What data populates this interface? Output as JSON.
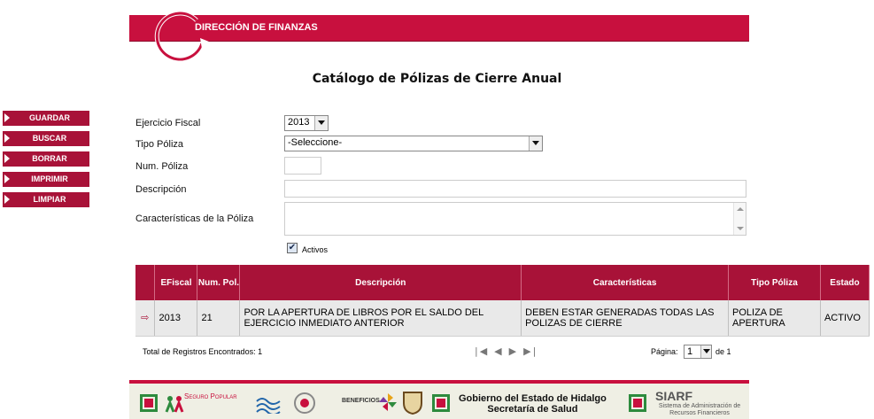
{
  "header": {
    "title": "DIRECCIÓN DE FINANZAS"
  },
  "page_title": "Catálogo de Pólizas de Cierre Anual",
  "side_menu": [
    "GUARDAR",
    "BUSCAR",
    "BORRAR",
    "IMPRIMIR",
    "LIMPIAR"
  ],
  "form": {
    "ejercicio_label": "Ejercicio Fiscal",
    "ejercicio_value": "2013",
    "tipo_label": "Tipo Póliza",
    "tipo_value": "-Seleccione-",
    "num_label": "Num. Póliza",
    "num_value": "",
    "desc_label": "Descripción",
    "desc_value": "",
    "carac_label": "Características de la Póliza",
    "carac_value": "",
    "activos_label": "Activos",
    "activos_checked": true
  },
  "table": {
    "headers": [
      "",
      "EFiscal",
      "Num. Pol.",
      "Descripción",
      "Características",
      "Tipo Póliza",
      "Estado"
    ],
    "rows": [
      {
        "efiscal": "2013",
        "num": "21",
        "descripcion": "POR LA APERTURA DE LIBROS POR EL SALDO DEL EJERCICIO INMEDIATO ANTERIOR",
        "caracteristicas": "DEBEN ESTAR GENERADAS TODAS LAS POLIZAS DE CIERRE",
        "tipo": "POLIZA DE APERTURA",
        "estado": "ACTIVO"
      }
    ]
  },
  "footer_bar": {
    "total": "Total de Registros Encontrados: 1",
    "page_label": "Página:",
    "page_value": "1",
    "page_of": "de 1"
  },
  "footer": {
    "seguro": "Seguro Popular",
    "beneficios": "BENEFICIOS",
    "gov_line1": "Gobierno del Estado de Hidalgo",
    "gov_line2": "Secretaría de Salud",
    "siarf": "SIARF",
    "siarf_sub": "Sistema de Administración de Recursos Financieros"
  },
  "colors": {
    "brand": "#c8103e",
    "menu": "#a81238"
  }
}
